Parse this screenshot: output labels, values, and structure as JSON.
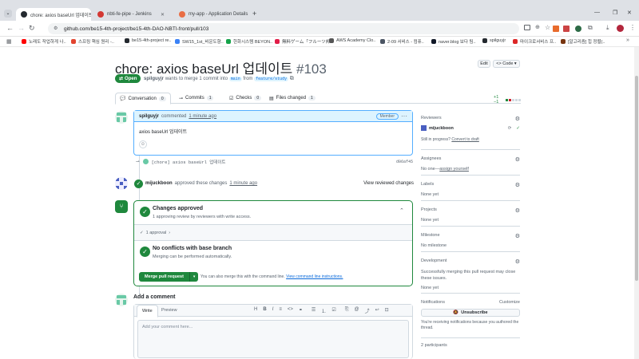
{
  "browser": {
    "tabs": [
      {
        "label": "chore: axios baseUrl 업데이트",
        "active": true,
        "icon": "github-icon",
        "color": "#24292f"
      },
      {
        "label": "nbti-fe-pipe - Jenkins",
        "active": false,
        "icon": "jenkins-icon",
        "color": "#d33833"
      },
      {
        "label": "my-app - Application Details",
        "active": false,
        "icon": "argo-icon",
        "color": "#e96d44"
      }
    ],
    "url": "github.com/be15-4th-project/be15-4th-DAO-NBTI-front/pull/103",
    "bookmarks": [
      {
        "label": "노래도 작업하게 나..",
        "color": "#ff0000"
      },
      {
        "label": "스프링 핵심 원리 -..",
        "color": "#e2442f"
      },
      {
        "label": "be15-4th-project re..",
        "color": "#24292f"
      },
      {
        "label": "SW15_1st_비운도향..",
        "color": "#3b82f6"
      },
      {
        "label": "한화시스템 BEYON..",
        "color": "#16a34a"
      },
      {
        "label": "無料ゲーム「フルーツ邦..",
        "color": "#e11d48"
      },
      {
        "label": "AWS Academy Clo..",
        "color": "#555555"
      },
      {
        "label": "2-09 서비스 - 컴퓨..",
        "color": "#4b5563"
      },
      {
        "label": "naver.blog 보다 팀..",
        "color": "#111827"
      },
      {
        "label": "spilguyjr",
        "color": "#24292f"
      },
      {
        "label": "마이크로서비스 프..",
        "color": "#dc2626"
      },
      {
        "label": "[알고리즘] 힙 정렬(..",
        "color": "#78350f"
      }
    ]
  },
  "pr": {
    "title": "chore: axios baseUrl 업데이트",
    "number": "#103",
    "edit_label": "Edit",
    "code_label": "<> Code ▾",
    "state": "Open",
    "author": "spilguyjr",
    "meta_text": "wants to merge 1 commit into",
    "base_branch": "main",
    "from_text": "from",
    "head_branch": "feature/study",
    "diffstat": "+1 −1"
  },
  "tabs": [
    {
      "label": "Conversation",
      "count": "0"
    },
    {
      "label": "Commits",
      "count": "1"
    },
    {
      "label": "Checks",
      "count": "0"
    },
    {
      "label": "Files changed",
      "count": "1"
    }
  ],
  "comment": {
    "author": "spilguyjr",
    "action": "commented",
    "time": "1 minute ago",
    "role": "Member",
    "body": "axios baseUrl 업데이트"
  },
  "commit": {
    "message": "[chore] axios baseUrl 업데이트",
    "sha": "d06af45"
  },
  "review": {
    "reviewer": "mijuckboon",
    "text": "approved these changes",
    "time": "1 minute ago",
    "view_label": "View reviewed changes"
  },
  "merge": {
    "approved_title": "Changes approved",
    "approved_sub": "1 approving review by reviewers with write access.",
    "approval_toggle": "1 approval",
    "conflict_title": "No conflicts with base branch",
    "conflict_sub": "Merging can be performed automatically.",
    "merge_button": "Merge pull request",
    "alt_text": "You can also merge this with the command line.",
    "cli_link": "View command line instructions."
  },
  "add_comment": {
    "heading": "Add a comment",
    "write_tab": "Write",
    "preview_tab": "Preview",
    "placeholder": "Add your comment here..."
  },
  "sidebar": {
    "reviewers_label": "Reviewers",
    "reviewer_name": "mijuckboon",
    "in_progress": "Still in progress?",
    "convert_draft": "Convert to draft",
    "assignees_label": "Assignees",
    "assignees_value": "No one—",
    "assign_yourself": "assign yourself",
    "labels_label": "Labels",
    "labels_value": "None yet",
    "projects_label": "Projects",
    "projects_value": "None yet",
    "milestone_label": "Milestone",
    "milestone_value": "No milestone",
    "development_label": "Development",
    "development_text": "Successfully merging this pull request may close these issues.",
    "development_value": "None yet",
    "notifications_label": "Notifications",
    "customize": "Customize",
    "unsubscribe": "Unsubscribe",
    "notify_text": "You're receiving notifications because you authored the thread.",
    "participants": "2 participants"
  },
  "colors": {
    "green": "#1f883d",
    "blue": "#0969da",
    "border": "#d1d9e0"
  }
}
